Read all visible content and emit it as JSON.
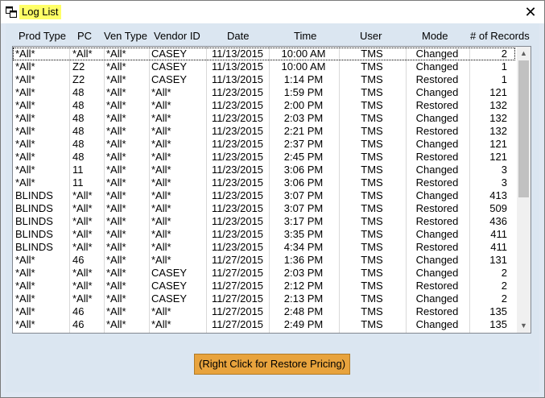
{
  "window": {
    "title": "Log List",
    "close_glyph": "✕"
  },
  "columns": [
    "Prod Type",
    "PC",
    "Ven Type",
    "Vendor ID",
    "Date",
    "Time",
    "User",
    "Mode",
    "# of Records"
  ],
  "rows": [
    [
      "*All*",
      "*All*",
      "*All*",
      "CASEY",
      "11/13/2015",
      "10:00 AM",
      "TMS",
      "Changed",
      "2"
    ],
    [
      "*All*",
      "Z2",
      "*All*",
      "CASEY",
      "11/13/2015",
      "10:00 AM",
      "TMS",
      "Changed",
      "1"
    ],
    [
      "*All*",
      "Z2",
      "*All*",
      "CASEY",
      "11/13/2015",
      "1:14 PM",
      "TMS",
      "Restored",
      "1"
    ],
    [
      "*All*",
      "48",
      "*All*",
      "*All*",
      "11/23/2015",
      "1:59 PM",
      "TMS",
      "Changed",
      "121"
    ],
    [
      "*All*",
      "48",
      "*All*",
      "*All*",
      "11/23/2015",
      "2:00 PM",
      "TMS",
      "Restored",
      "132"
    ],
    [
      "*All*",
      "48",
      "*All*",
      "*All*",
      "11/23/2015",
      "2:03 PM",
      "TMS",
      "Changed",
      "132"
    ],
    [
      "*All*",
      "48",
      "*All*",
      "*All*",
      "11/23/2015",
      "2:21 PM",
      "TMS",
      "Restored",
      "132"
    ],
    [
      "*All*",
      "48",
      "*All*",
      "*All*",
      "11/23/2015",
      "2:37 PM",
      "TMS",
      "Changed",
      "121"
    ],
    [
      "*All*",
      "48",
      "*All*",
      "*All*",
      "11/23/2015",
      "2:45 PM",
      "TMS",
      "Restored",
      "121"
    ],
    [
      "*All*",
      "11",
      "*All*",
      "*All*",
      "11/23/2015",
      "3:06 PM",
      "TMS",
      "Changed",
      "3"
    ],
    [
      "*All*",
      "11",
      "*All*",
      "*All*",
      "11/23/2015",
      "3:06 PM",
      "TMS",
      "Restored",
      "3"
    ],
    [
      "BLINDS",
      "*All*",
      "*All*",
      "*All*",
      "11/23/2015",
      "3:07 PM",
      "TMS",
      "Changed",
      "413"
    ],
    [
      "BLINDS",
      "*All*",
      "*All*",
      "*All*",
      "11/23/2015",
      "3:07 PM",
      "TMS",
      "Restored",
      "509"
    ],
    [
      "BLINDS",
      "*All*",
      "*All*",
      "*All*",
      "11/23/2015",
      "3:17 PM",
      "TMS",
      "Restored",
      "436"
    ],
    [
      "BLINDS",
      "*All*",
      "*All*",
      "*All*",
      "11/23/2015",
      "3:35 PM",
      "TMS",
      "Changed",
      "411"
    ],
    [
      "BLINDS",
      "*All*",
      "*All*",
      "*All*",
      "11/23/2015",
      "4:34 PM",
      "TMS",
      "Restored",
      "411"
    ],
    [
      "*All*",
      "46",
      "*All*",
      "*All*",
      "11/27/2015",
      "1:36 PM",
      "TMS",
      "Changed",
      "131"
    ],
    [
      "*All*",
      "*All*",
      "*All*",
      "CASEY",
      "11/27/2015",
      "2:03 PM",
      "TMS",
      "Changed",
      "2"
    ],
    [
      "*All*",
      "*All*",
      "*All*",
      "CASEY",
      "11/27/2015",
      "2:12 PM",
      "TMS",
      "Restored",
      "2"
    ],
    [
      "*All*",
      "*All*",
      "*All*",
      "CASEY",
      "11/27/2015",
      "2:13 PM",
      "TMS",
      "Changed",
      "2"
    ],
    [
      "*All*",
      "46",
      "*All*",
      "*All*",
      "11/27/2015",
      "2:48 PM",
      "TMS",
      "Restored",
      "135"
    ],
    [
      "*All*",
      "46",
      "*All*",
      "*All*",
      "11/27/2015",
      "2:49 PM",
      "TMS",
      "Changed",
      "135"
    ]
  ],
  "scrollbar": {
    "up_glyph": "▲",
    "down_glyph": "▼"
  },
  "hint": "(Right Click for Restore Pricing)"
}
